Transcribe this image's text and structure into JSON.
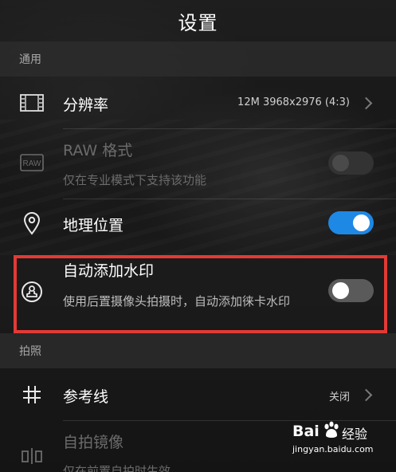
{
  "header": {
    "title": "设置"
  },
  "sections": {
    "general": "通用",
    "photo": "拍照"
  },
  "rows": {
    "resolution": {
      "title": "分辨率",
      "value": "12M 3968x2976 (4:3)",
      "icon": "resolution-frame-icon"
    },
    "raw": {
      "title": "RAW 格式",
      "subtitle": "仅在专业模式下支持该功能",
      "icon": "raw-icon",
      "icon_text": "RAW",
      "enabled": false,
      "toggle": false
    },
    "location": {
      "title": "地理位置",
      "icon": "location-pin-icon",
      "toggle": true
    },
    "watermark": {
      "title": "自动添加水印",
      "subtitle": "使用后置摄像头拍摄时，自动添加徕卡水印",
      "icon": "stamp-icon",
      "toggle": false
    },
    "grid": {
      "title": "参考线",
      "value": "关闭",
      "icon": "grid-hash-icon"
    },
    "mirror": {
      "title": "自拍镜像",
      "subtitle": "仅在前置自拍时生效",
      "icon": "mirror-icon",
      "enabled": false
    }
  },
  "watermark_overlay": {
    "brand": "Bai",
    "suffix": "经验",
    "url": "jingyan.baidu.com"
  },
  "colors": {
    "accent": "#1e88e5",
    "highlight": "#e23a36"
  }
}
